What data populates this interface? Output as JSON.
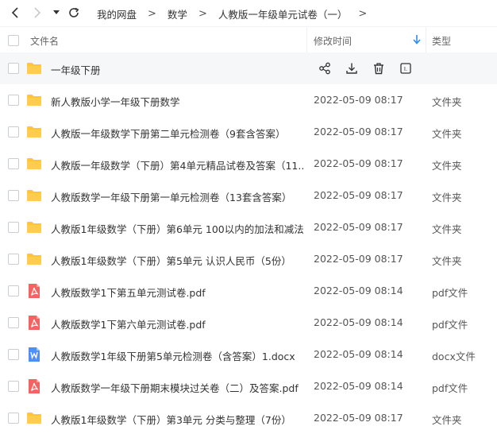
{
  "nav": {
    "back_icon": "chevron-left-icon",
    "forward_icon": "chevron-right-icon",
    "history_icon": "caret-down-icon",
    "refresh_icon": "refresh-icon"
  },
  "breadcrumb": {
    "items": [
      "我的网盘",
      "数学",
      "人教版一年级单元试卷（一）"
    ]
  },
  "header": {
    "name": "文件名",
    "time": "修改时间",
    "type": "类型"
  },
  "colors": {
    "folder": "#ffc53d",
    "pdf": "#f26464",
    "docx": "#4d8ef7",
    "hover_row": "#f6f7f9",
    "sort_arrow": "#2e8cf0"
  },
  "hover_actions": [
    "share-icon",
    "download-icon",
    "delete-icon",
    "more-icon"
  ],
  "files": [
    {
      "icon": "folder",
      "name": "一年级下册",
      "time": "",
      "type": ""
    },
    {
      "icon": "folder",
      "name": "新人教版小学一年级下册数学",
      "time": "2022-05-09 08:17",
      "type": "文件夹"
    },
    {
      "icon": "folder",
      "name": "人教版一年级数学下册第二单元检测卷（9套含答案）",
      "time": "2022-05-09 08:17",
      "type": "文件夹"
    },
    {
      "icon": "folder",
      "name": "人教版一年级数学（下册）第4单元精品试卷及答案（11...",
      "time": "2022-05-09 08:17",
      "type": "文件夹"
    },
    {
      "icon": "folder",
      "name": "人教版数学一年级下册第一单元检测卷（13套含答案）",
      "time": "2022-05-09 08:17",
      "type": "文件夹"
    },
    {
      "icon": "folder",
      "name": "人教版1年级数学（下册）第6单元 100以内的加法和减法...",
      "time": "2022-05-09 08:17",
      "type": "文件夹"
    },
    {
      "icon": "folder",
      "name": "人教版1年级数学（下册）第5单元 认识人民币（5份）",
      "time": "2022-05-09 08:17",
      "type": "文件夹"
    },
    {
      "icon": "pdf",
      "name": "人教版数学1下第五单元测试卷.pdf",
      "time": "2022-05-09 08:14",
      "type": "pdf文件"
    },
    {
      "icon": "pdf",
      "name": "人教版数学1下第六单元测试卷.pdf",
      "time": "2022-05-09 08:14",
      "type": "pdf文件"
    },
    {
      "icon": "docx",
      "name": "人教版数学1年级下册第5单元检测卷（含答案）1.docx",
      "time": "2022-05-09 08:14",
      "type": "docx文件"
    },
    {
      "icon": "pdf",
      "name": "人教版数学一年级下册期末模块过关卷（二）及答案.pdf",
      "time": "2022-05-09 08:14",
      "type": "pdf文件"
    },
    {
      "icon": "folder",
      "name": "人教版1年级数学（下册）第3单元 分类与整理（7份）",
      "time": "2022-05-09 08:17",
      "type": "文件夹"
    }
  ]
}
